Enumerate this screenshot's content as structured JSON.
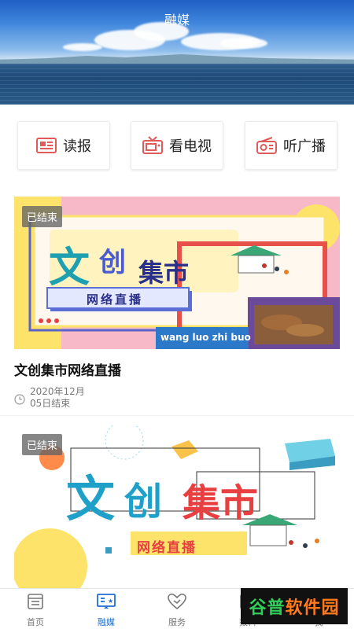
{
  "header": {
    "title": "融媒"
  },
  "quick": [
    {
      "label": "读报",
      "icon": "newspaper-icon"
    },
    {
      "label": "看电视",
      "icon": "tv-icon"
    },
    {
      "label": "听广播",
      "icon": "radio-icon"
    }
  ],
  "cards": [
    {
      "badge": "已结束",
      "title": "文创集市网络直播",
      "date": "2020年12月\n05日结束",
      "poster": {
        "big1": "文",
        "big2": "创",
        "big3": "集市",
        "stripe": "网络直播",
        "pinyin": "wang luo zhi buo"
      }
    },
    {
      "badge": "已结束",
      "poster": {
        "big1": "文",
        "big2": "创",
        "big3": "集市",
        "stripe": "网络直播"
      }
    }
  ],
  "nav": [
    {
      "label": "首页",
      "icon": "home-icon"
    },
    {
      "label": "融媒",
      "icon": "media-icon"
    },
    {
      "label": "服务",
      "icon": "heart-service-icon"
    },
    {
      "label": "报料",
      "icon": "report-icon"
    },
    {
      "label": "我",
      "icon": "profile-icon"
    }
  ],
  "colors": {
    "accent": "#1e6fd4",
    "card_pink": "#f7b9c7",
    "title_teal": "#1aa3b8",
    "red": "#e84040"
  },
  "watermark": {
    "part1": "谷普",
    "part2": "软件园"
  }
}
